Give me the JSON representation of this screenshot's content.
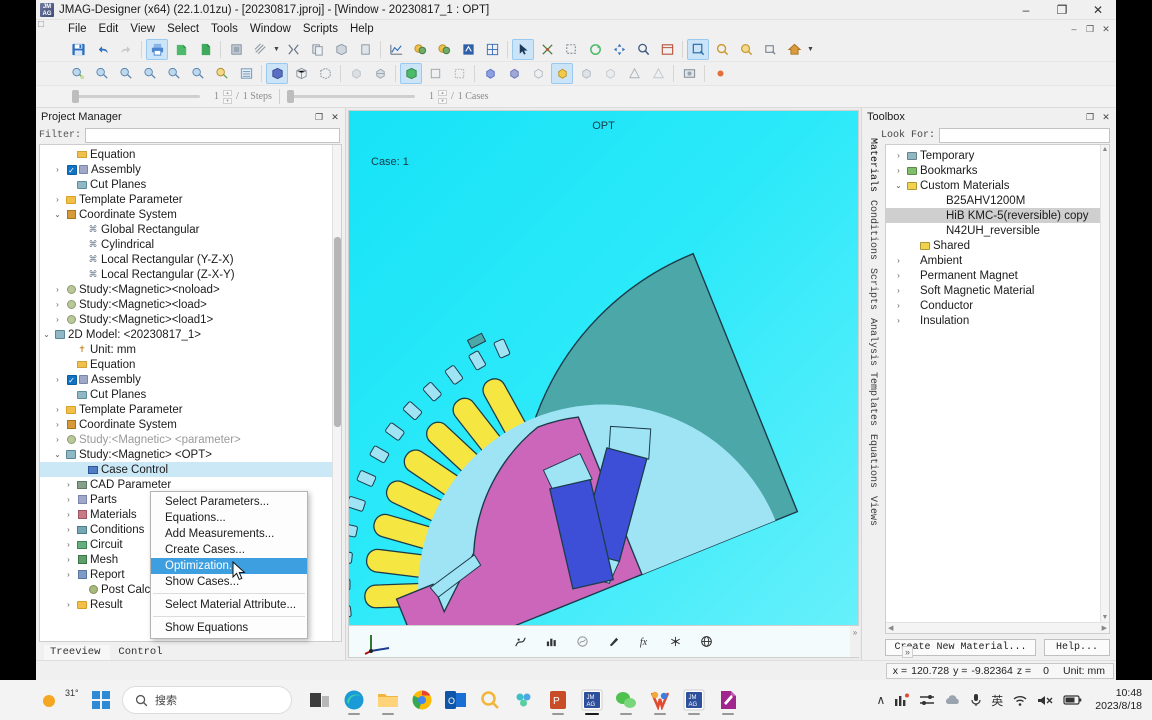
{
  "window": {
    "title": "JMAG-Designer (x64) (22.1.01zu) - [20230817.jproj] - [Window - 20230817_1 : OPT]",
    "minimize": "–",
    "maximize": "❐",
    "close": "✕",
    "mdi_restore": "❐",
    "mdi_minimize": "–",
    "mdi_close": "✕"
  },
  "menubar": {
    "items": [
      "File",
      "Edit",
      "View",
      "Select",
      "Tools",
      "Window",
      "Scripts",
      "Help"
    ]
  },
  "step_slider": {
    "value": "1",
    "separator": "/",
    "total": "1 Steps"
  },
  "case_slider": {
    "value": "1",
    "separator": "/",
    "total": "1 Cases"
  },
  "project_manager": {
    "title": "Project Manager",
    "float_btn": "❐",
    "close_btn": "✕",
    "filter_label": "Filter:",
    "filter_value": "",
    "tabs": [
      {
        "label": "Treeview",
        "active": true
      },
      {
        "label": "Control",
        "active": false
      }
    ],
    "tree": [
      {
        "label": "Equation",
        "indent": 2,
        "expander": "",
        "icon": "ic-eq",
        "state": ""
      },
      {
        "label": "Assembly",
        "indent": 1,
        "expander": "›",
        "icon": "ic-chk-asm",
        "state": ""
      },
      {
        "label": "Cut Planes",
        "indent": 2,
        "expander": "",
        "icon": "ic-cut",
        "state": ""
      },
      {
        "label": "Template Parameter",
        "indent": 1,
        "expander": "›",
        "icon": "ic-folder",
        "state": ""
      },
      {
        "label": "Coordinate System",
        "indent": 1,
        "expander": "⌄",
        "icon": "ic-cs",
        "state": ""
      },
      {
        "label": "Global Rectangular",
        "indent": 3,
        "expander": "",
        "icon": "ic-axis",
        "state": ""
      },
      {
        "label": "Cylindrical",
        "indent": 3,
        "expander": "",
        "icon": "ic-axis",
        "state": ""
      },
      {
        "label": "Local Rectangular (Y-Z-X)",
        "indent": 3,
        "expander": "",
        "icon": "ic-axis",
        "state": ""
      },
      {
        "label": "Local Rectangular (Z-X-Y)",
        "indent": 3,
        "expander": "",
        "icon": "ic-axis",
        "state": ""
      },
      {
        "label": "Study:<Magnetic><noload>",
        "indent": 1,
        "expander": "›",
        "icon": "ic-study",
        "state": ""
      },
      {
        "label": "Study:<Magnetic><load>",
        "indent": 1,
        "expander": "›",
        "icon": "ic-study",
        "state": ""
      },
      {
        "label": "Study:<Magnetic><load1>",
        "indent": 1,
        "expander": "›",
        "icon": "ic-study",
        "state": ""
      },
      {
        "label": "2D Model: <20230817_1>",
        "indent": 0,
        "expander": "⌄",
        "icon": "ic-model",
        "state": ""
      },
      {
        "label": "Unit: mm",
        "indent": 2,
        "expander": "",
        "icon": "ic-unit",
        "state": ""
      },
      {
        "label": "Equation",
        "indent": 2,
        "expander": "",
        "icon": "ic-eq",
        "state": ""
      },
      {
        "label": "Assembly",
        "indent": 1,
        "expander": "›",
        "icon": "ic-chk-asm",
        "state": ""
      },
      {
        "label": "Cut Planes",
        "indent": 2,
        "expander": "",
        "icon": "ic-cut",
        "state": ""
      },
      {
        "label": "Template Parameter",
        "indent": 1,
        "expander": "›",
        "icon": "ic-folder",
        "state": ""
      },
      {
        "label": "Coordinate System",
        "indent": 1,
        "expander": "›",
        "icon": "ic-cs",
        "state": ""
      },
      {
        "label": "Study:<Magnetic> <parameter>",
        "indent": 1,
        "expander": "›",
        "icon": "ic-study",
        "state": "dim"
      },
      {
        "label": "Study:<Magnetic> <OPT>",
        "indent": 1,
        "expander": "⌄",
        "icon": "ic-model",
        "state": ""
      },
      {
        "label": "Case Control",
        "indent": 3,
        "expander": "",
        "icon": "ic-case",
        "state": "sel"
      },
      {
        "label": "CAD Parameter",
        "indent": 2,
        "expander": "›",
        "icon": "ic-cad",
        "state": ""
      },
      {
        "label": "Parts",
        "indent": 2,
        "expander": "›",
        "icon": "ic-part",
        "state": ""
      },
      {
        "label": "Materials",
        "indent": 2,
        "expander": "›",
        "icon": "ic-mat",
        "state": ""
      },
      {
        "label": "Conditions",
        "indent": 2,
        "expander": "›",
        "icon": "ic-cond",
        "state": ""
      },
      {
        "label": "Circuit",
        "indent": 2,
        "expander": "›",
        "icon": "ic-circ",
        "state": ""
      },
      {
        "label": "Mesh",
        "indent": 2,
        "expander": "›",
        "icon": "ic-mesh",
        "state": ""
      },
      {
        "label": "Report",
        "indent": 2,
        "expander": "›",
        "icon": "ic-rep",
        "state": ""
      },
      {
        "label": "Post Calculation",
        "indent": 3,
        "expander": "",
        "icon": "ic-post",
        "state": ""
      },
      {
        "label": "Result",
        "indent": 2,
        "expander": "›",
        "icon": "ic-res",
        "state": ""
      }
    ]
  },
  "context_menu": {
    "items": [
      {
        "label": "Select Parameters...",
        "highlight": false,
        "divider_after": false
      },
      {
        "label": "Equations...",
        "highlight": false,
        "divider_after": false
      },
      {
        "label": "Add Measurements...",
        "highlight": false,
        "divider_after": false
      },
      {
        "label": "Create Cases...",
        "highlight": false,
        "divider_after": false
      },
      {
        "label": "Optimization...",
        "highlight": true,
        "divider_after": false
      },
      {
        "label": "Show Cases...",
        "highlight": false,
        "divider_after": true
      },
      {
        "label": "Select Material Attribute...",
        "highlight": false,
        "divider_after": true
      },
      {
        "label": "Show Equations",
        "highlight": false,
        "divider_after": false
      }
    ]
  },
  "viewport": {
    "title": "OPT",
    "case_label": "Case: 1",
    "background_color": "#1fe8f8",
    "model_colors": {
      "rotor": "#cc66bb",
      "stator": "#4ca8a8",
      "coil": "#f5e642",
      "magnet": "#3d4fd6",
      "air": "#aee8f7"
    },
    "bottom_icons": [
      "contour-plot-icon",
      "bar-graph-icon",
      "circle-plot-icon",
      "vector-icon",
      "function-icon",
      "particle-icon",
      "grid-icon"
    ]
  },
  "toolbox": {
    "title": "Toolbox",
    "float_btn": "❐",
    "close_btn": "✕",
    "look_for_label": "Look For:",
    "look_for_value": "",
    "vtabs": [
      {
        "label": "Materials",
        "active": true
      },
      {
        "label": "Conditions",
        "active": false
      },
      {
        "label": "Scripts",
        "active": false
      },
      {
        "label": "Analysis Templates",
        "active": false
      },
      {
        "label": "Equations",
        "active": false
      },
      {
        "label": "Views",
        "active": false
      }
    ],
    "tree": [
      {
        "label": "Temporary",
        "indent": 0,
        "expander": "›",
        "icon": "folder-blue",
        "state": ""
      },
      {
        "label": "Bookmarks",
        "indent": 0,
        "expander": "›",
        "icon": "folder-green",
        "state": ""
      },
      {
        "label": "Custom Materials",
        "indent": 0,
        "expander": "⌄",
        "icon": "folder-yellow",
        "state": ""
      },
      {
        "label": "B25AHV1200M",
        "indent": 2,
        "expander": "",
        "icon": "none",
        "state": ""
      },
      {
        "label": "HiB KMC-5(reversible) copy",
        "indent": 2,
        "expander": "",
        "icon": "none",
        "state": "sel"
      },
      {
        "label": "N42UH_reversible",
        "indent": 2,
        "expander": "",
        "icon": "none",
        "state": ""
      },
      {
        "label": "Shared",
        "indent": 1,
        "expander": "",
        "icon": "folder-yellow",
        "state": ""
      },
      {
        "label": "Ambient",
        "indent": 0,
        "expander": "›",
        "icon": "none",
        "state": ""
      },
      {
        "label": "Permanent Magnet",
        "indent": 0,
        "expander": "›",
        "icon": "none",
        "state": ""
      },
      {
        "label": "Soft Magnetic Material",
        "indent": 0,
        "expander": "›",
        "icon": "none",
        "state": ""
      },
      {
        "label": "Conductor",
        "indent": 0,
        "expander": "›",
        "icon": "none",
        "state": ""
      },
      {
        "label": "Insulation",
        "indent": 0,
        "expander": "›",
        "icon": "none",
        "state": ""
      }
    ],
    "create_new_material_button": "Create New Material...",
    "help_button": "Help...",
    "expander_btn": "»"
  },
  "statusbar": {
    "x_label": "x =",
    "x_value": "120.728",
    "y_label": "y =",
    "y_value": "-9.82364",
    "z_label": "z =",
    "z_value": "0",
    "unit": "Unit: mm"
  },
  "taskbar": {
    "temperature": "31°",
    "search_placeholder": "搜索",
    "ime_label": "英",
    "time": "10:48",
    "date": "2023/8/18",
    "chevron": "∧"
  }
}
